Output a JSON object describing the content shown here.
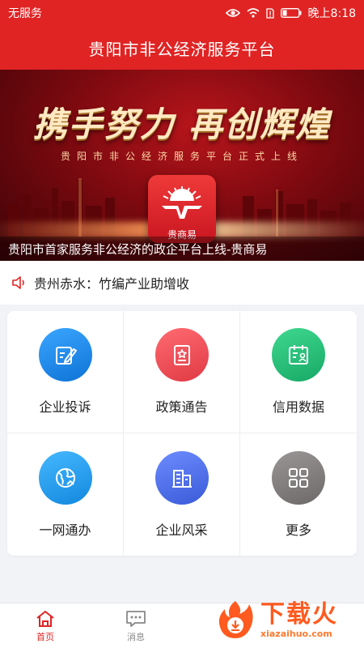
{
  "status_bar": {
    "carrier": "无服务",
    "time": "晚上8:18"
  },
  "app_bar": {
    "title": "贵阳市非公经济服务平台"
  },
  "banner": {
    "slogan": "携手努力 再创辉煌",
    "subline": "贵阳市非公经济服务平台正式上线",
    "logo_text": "贵商易",
    "caption": "贵阳市首家服务非公经济的政企平台上线-贵商易"
  },
  "notice": {
    "text": "贵州赤水：竹编产业助增收"
  },
  "services": [
    {
      "label": "企业投诉",
      "icon": "edit-icon",
      "color": "#1f8fe6"
    },
    {
      "label": "政策通告",
      "icon": "document-star-icon",
      "color": "#f04d55"
    },
    {
      "label": "信用数据",
      "icon": "calendar-user-icon",
      "color": "#27c07a"
    },
    {
      "label": "一网通办",
      "icon": "globe-icon",
      "color": "#1fa3e8"
    },
    {
      "label": "企业风采",
      "icon": "buildings-icon",
      "color": "#4d6fe8"
    },
    {
      "label": "更多",
      "icon": "grid-more-icon",
      "color": "#7d7a7a"
    }
  ],
  "tabs": [
    {
      "label": "首页",
      "icon": "home-icon",
      "active": true
    },
    {
      "label": "消息",
      "icon": "message-icon",
      "active": false
    }
  ],
  "watermark": {
    "title": "下载火",
    "url": "xiazaihuo.com"
  },
  "colors": {
    "primary": "#e02424",
    "background": "#f1f3f7"
  }
}
